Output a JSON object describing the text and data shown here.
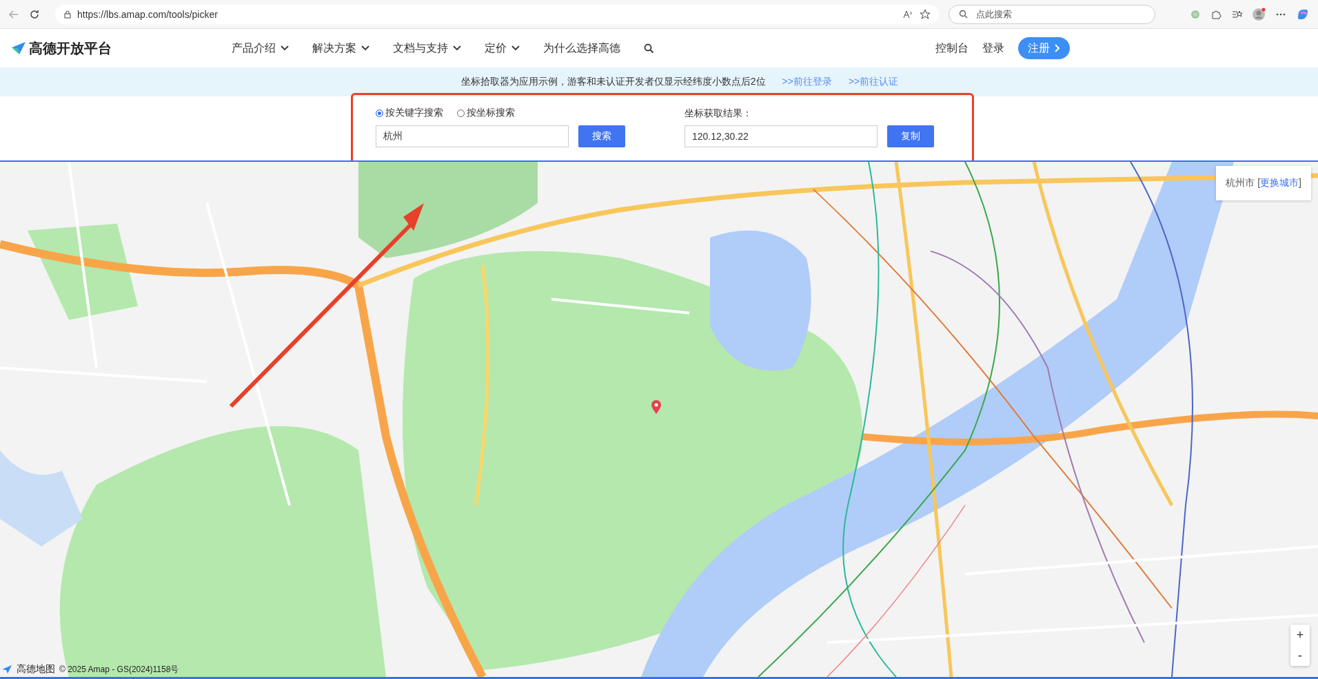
{
  "browser": {
    "url": "https://lbs.amap.com/tools/picker",
    "search_placeholder": "点此搜索"
  },
  "header": {
    "logo": "高德开放平台",
    "nav": [
      {
        "label": "产品介绍",
        "dropdown": true
      },
      {
        "label": "解决方案",
        "dropdown": true
      },
      {
        "label": "文档与支持",
        "dropdown": true
      },
      {
        "label": "定价",
        "dropdown": true
      },
      {
        "label": "为什么选择高德",
        "dropdown": false
      }
    ],
    "console": "控制台",
    "login": "登录",
    "register": "注册"
  },
  "notice": {
    "text": "坐标拾取器为应用示例，游客和未认证开发者仅显示经纬度小数点后2位",
    "links": [
      ">>前往登录",
      ">>前往认证"
    ]
  },
  "picker": {
    "modes": [
      {
        "label": "按关键字搜索",
        "selected": true
      },
      {
        "label": "按坐标搜索",
        "selected": false
      }
    ],
    "keyword": "杭州",
    "search_button": "搜索",
    "result_label": "坐标获取结果：",
    "result": "120.12,30.22",
    "copy_button": "复制"
  },
  "map": {
    "city": "杭州市 [",
    "change_city": "更换城市",
    "city_end": "]",
    "zoom_in": "+",
    "zoom_out": "-",
    "brand": "高德地图",
    "copyright": "© 2025 Amap - GS(2024)1158号"
  }
}
